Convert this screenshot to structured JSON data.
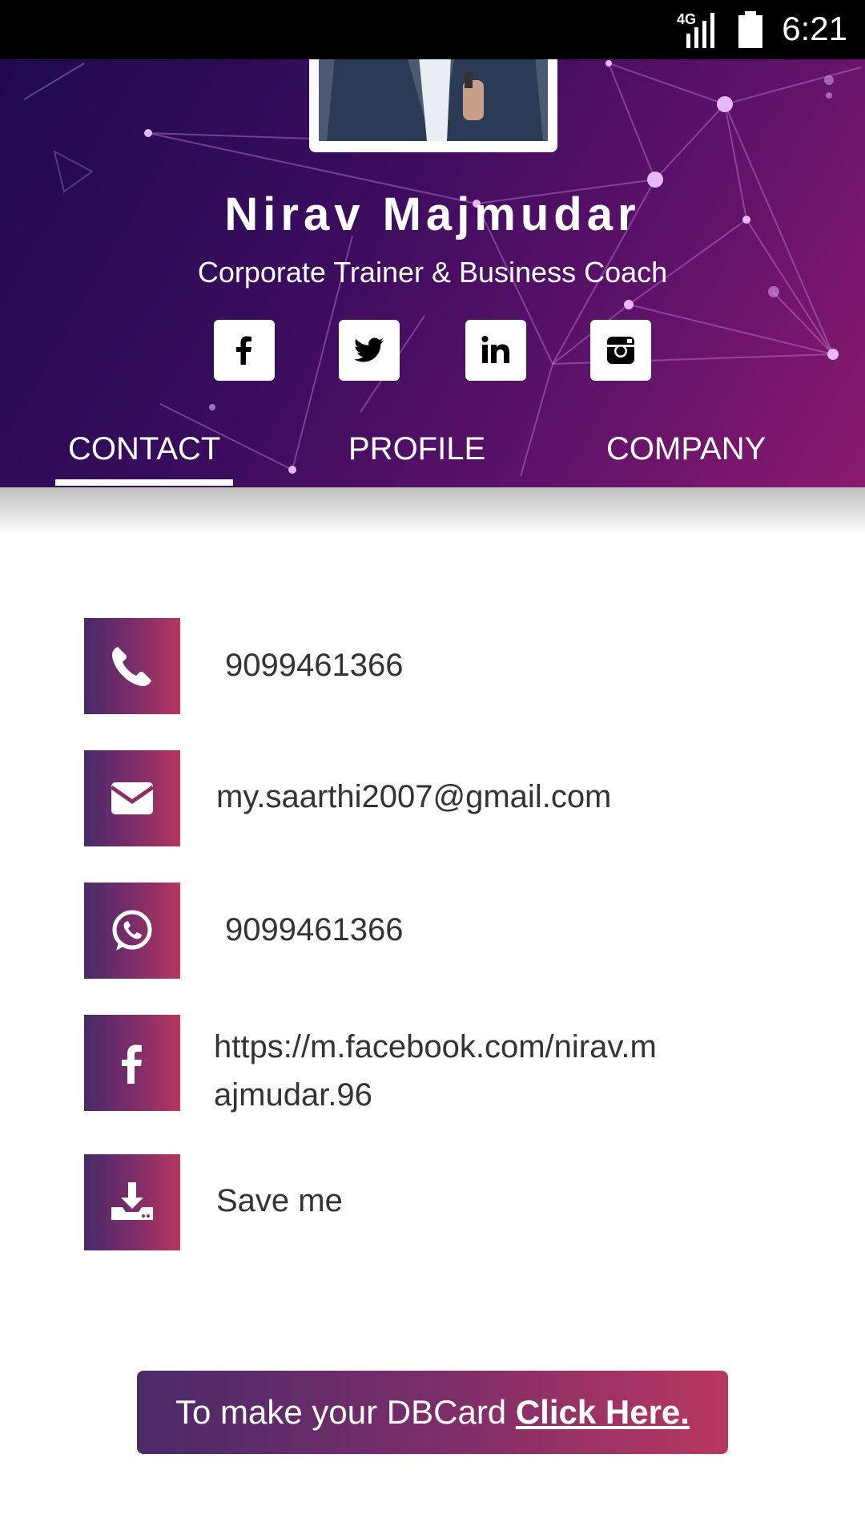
{
  "status_bar": {
    "network": "4G",
    "time": "6:21"
  },
  "profile": {
    "name": "Nirav Majmudar",
    "tagline": "Corporate Trainer & Business Coach"
  },
  "social_links": [
    {
      "name": "facebook",
      "icon": "facebook-icon"
    },
    {
      "name": "twitter",
      "icon": "twitter-icon"
    },
    {
      "name": "linkedin",
      "icon": "linkedin-icon"
    },
    {
      "name": "instagram",
      "icon": "instagram-icon"
    }
  ],
  "tabs": [
    {
      "label": "CONTACT",
      "active": true
    },
    {
      "label": "PROFILE",
      "active": false
    },
    {
      "label": "COMPANY",
      "active": false
    }
  ],
  "contact": {
    "phone": "9099461366",
    "email": "my.saarthi2007@gmail.com",
    "whatsapp": "9099461366",
    "facebook_line1": "https://m.facebook.com/nirav.m",
    "facebook_line2": "ajmudar.96",
    "save": "Save me"
  },
  "cta": {
    "text": "To make your DBCard ",
    "link": "Click Here."
  },
  "colors": {
    "header_start": "#1e0a4f",
    "header_end": "#8a1a6e",
    "accent_start": "#4a2a68",
    "accent_end": "#b8375f",
    "text": "#333333"
  }
}
